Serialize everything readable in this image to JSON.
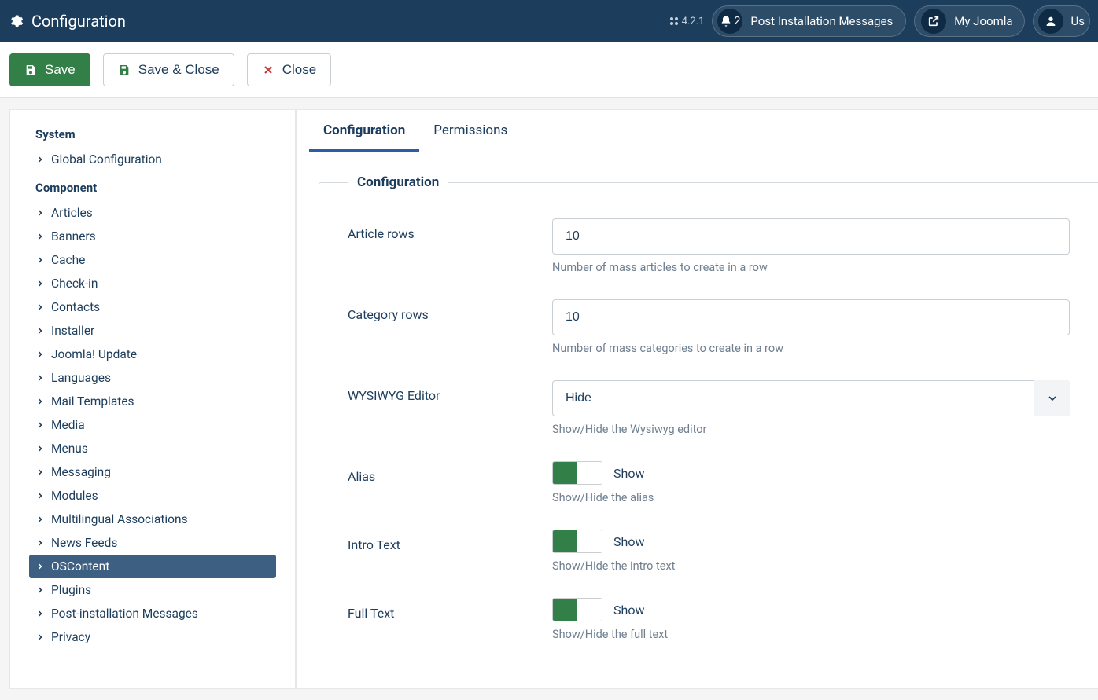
{
  "topbar": {
    "title": "Configuration",
    "version": "4.2.1",
    "notif_count": "2",
    "post_install": "Post Installation Messages",
    "site_name": "My Joomla",
    "user_label": "Us"
  },
  "toolbar": {
    "save": "Save",
    "save_close": "Save & Close",
    "close": "Close"
  },
  "sidebar": {
    "system_heading": "System",
    "global_config": "Global Configuration",
    "component_heading": "Component",
    "items": [
      "Articles",
      "Banners",
      "Cache",
      "Check-in",
      "Contacts",
      "Installer",
      "Joomla! Update",
      "Languages",
      "Mail Templates",
      "Media",
      "Menus",
      "Messaging",
      "Modules",
      "Multilingual Associations",
      "News Feeds",
      "OSContent",
      "Plugins",
      "Post-installation Messages",
      "Privacy"
    ],
    "active_index": 15
  },
  "tabs": {
    "config": "Configuration",
    "perm": "Permissions"
  },
  "fieldset": {
    "legend": "Configuration",
    "article_rows": {
      "label": "Article rows",
      "value": "10",
      "help": "Number of mass articles to create in a row"
    },
    "category_rows": {
      "label": "Category rows",
      "value": "10",
      "help": "Number of mass categories to create in a row"
    },
    "wysiwyg": {
      "label": "WYSIWYG Editor",
      "value": "Hide",
      "help": "Show/Hide the Wysiwyg editor"
    },
    "alias": {
      "label": "Alias",
      "state": "Show",
      "help": "Show/Hide the alias"
    },
    "intro": {
      "label": "Intro Text",
      "state": "Show",
      "help": "Show/Hide the intro text"
    },
    "full": {
      "label": "Full Text",
      "state": "Show",
      "help": "Show/Hide the full text"
    }
  }
}
